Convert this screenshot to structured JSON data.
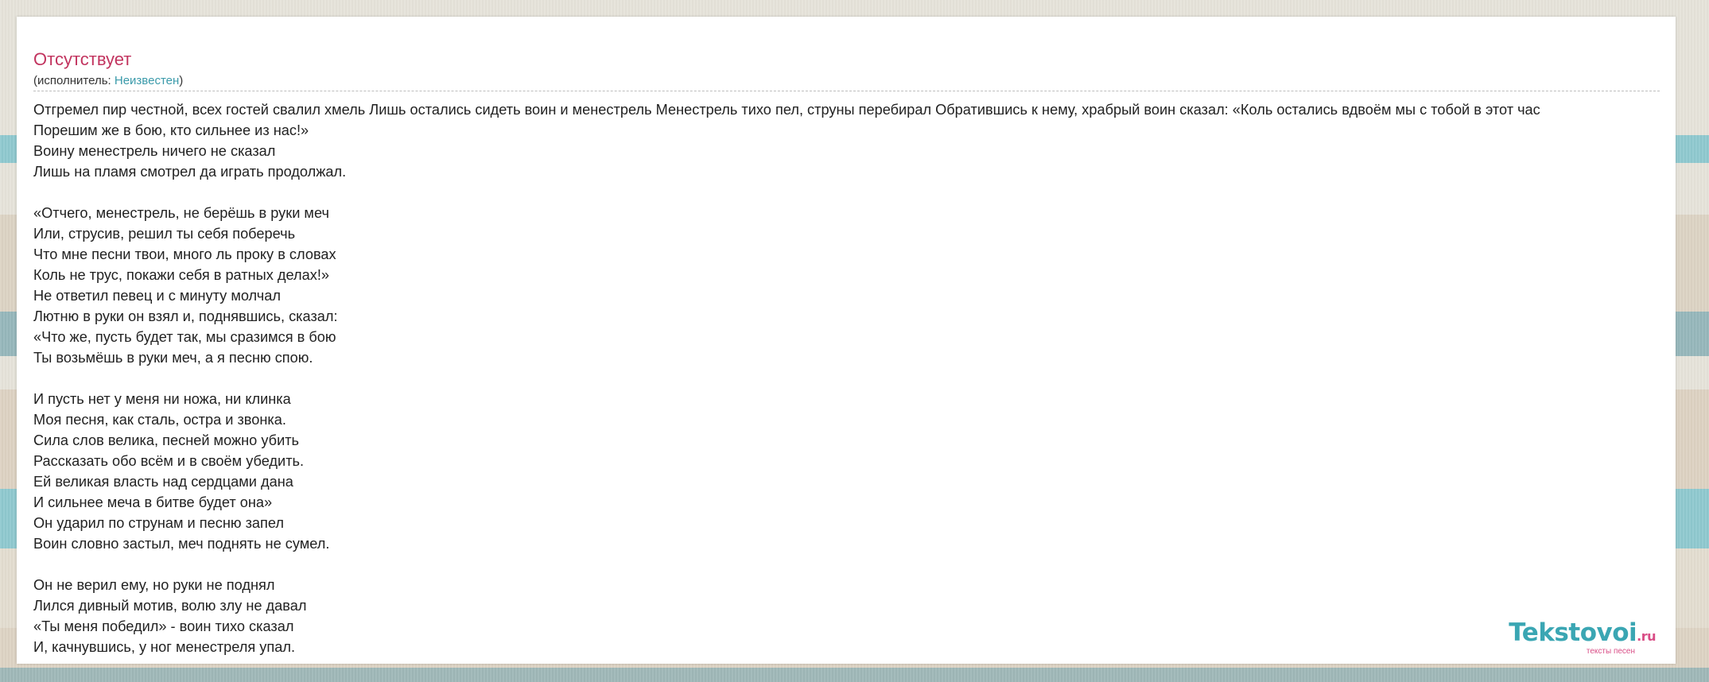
{
  "song": {
    "title": "Отсутствует",
    "performer_prefix": "(исполнитель: ",
    "performer_name": "Неизвестен",
    "performer_suffix": ")"
  },
  "lyrics": [
    "Отгремел пир честной, всех гостей свалил хмель Лишь остались сидеть воин и менестрель Менестрель тихо пел, струны перебирал Обратившись к нему, храбрый воин сказал: «Коль остались вдвоём мы с тобой в этот час",
    "Порешим же в бою, кто сильнее из нас!»",
    "Воину менестрель ничего не сказал",
    "Лишь на пламя смотрел да играть продолжал.",
    "",
    "«Отчего, менестрель, не берёшь в руки меч",
    "Или, струсив, решил ты себя поберечь",
    "Что мне песни твои, много ль проку в словах",
    "Коль не трус, покажи себя в ратных делах!»",
    "Не ответил певец и с минуту молчал",
    "Лютню в руки он взял и, поднявшись, сказал:",
    "«Что же, пусть будет так, мы сразимся в бою",
    "Ты возьмёшь в руки меч, а я песню спою.",
    "",
    "И пусть нет у меня ни ножа, ни клинка",
    "Моя песня, как сталь, остра и звонка.",
    "Сила слов велика, песней можно убить",
    "Рассказать обо всём и в своём убедить.",
    "Ей великая власть над сердцами дана",
    "И сильнее меча в битве будет она»",
    "Он ударил по струнам и песню запел",
    "Воин словно застыл, меч поднять не сумел.",
    "",
    "Он не верил ему, но руки не поднял",
    "Лился дивный мотив, волю злу не давал",
    "«Ты меня победил» - воин тихо сказал",
    "И, качнувшись, у ног менестреля упал."
  ],
  "logo": {
    "main": "Tekstovoi",
    "suffix": ".ru",
    "tagline": "тексты песен"
  },
  "colors": {
    "title": "#c2345f",
    "link": "#3a9aaa",
    "logo_main": "#3aa6b3",
    "logo_accent": "#d94d86"
  }
}
